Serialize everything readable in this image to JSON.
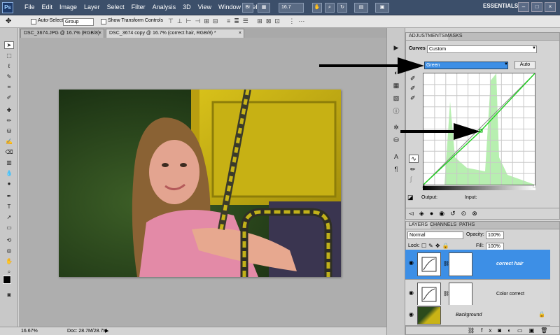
{
  "menubar": {
    "logo": "Ps",
    "items": [
      "File",
      "Edit",
      "Image",
      "Layer",
      "Select",
      "Filter",
      "Analysis",
      "3D",
      "View",
      "Window",
      "Help"
    ],
    "bridge": "Br",
    "zoom": "16.7",
    "workspace": "ESSENTIALS",
    "win_min": "–",
    "win_max": "□",
    "win_close": "×"
  },
  "options": {
    "auto_select_label": "Auto-Select:",
    "auto_select_value": "Group",
    "show_transform_label": "Show Transform Controls"
  },
  "tabs": [
    {
      "label": "DSC_3674.JPG @ 16.7% (RGB/8)",
      "close": "×"
    },
    {
      "label": "DSC_3674 copy @ 16.7% (correct hair, RGB/8) *",
      "close": "×"
    }
  ],
  "status": {
    "zoom": "16.67%",
    "doc": "Doc: 28.7M/28.7M"
  },
  "adjustments": {
    "tab_adjustments": "ADJUSTMENTS",
    "tab_masks": "MASKS",
    "title": "Curves",
    "preset": "Custom",
    "channel": "Green",
    "auto_label": "Auto",
    "output_label": "Output:",
    "input_label": "Input:"
  },
  "layers_panel": {
    "tab_layers": "LAYERS",
    "tab_channels": "CHANNELS",
    "tab_paths": "PATHS",
    "blend_mode": "Normal",
    "opacity_label": "Opacity:",
    "opacity_value": "100%",
    "lock_label": "Lock:",
    "fill_label": "Fill:",
    "fill_value": "100%",
    "layers": [
      {
        "name": "correct hair",
        "selected": true
      },
      {
        "name": "Color correct",
        "selected": false
      },
      {
        "name": "Background",
        "selected": false
      }
    ]
  },
  "colors": {
    "accent": "#3d8fe6",
    "curve": "#1ed21e"
  }
}
